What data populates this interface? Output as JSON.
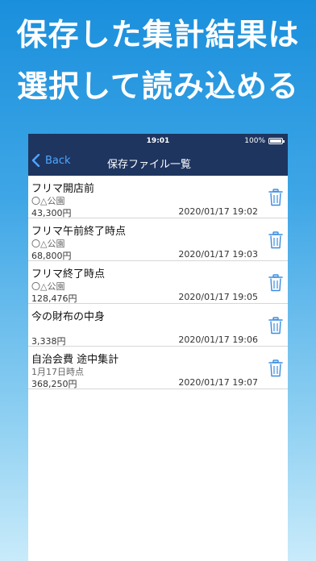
{
  "headline": {
    "line1": "保存した集計結果は",
    "line2": "選択して読み込める"
  },
  "status_bar": {
    "time": "19:01",
    "battery": "100%"
  },
  "nav": {
    "back_label": "Back",
    "title": "保存ファイル一覧"
  },
  "files": [
    {
      "title": "フリマ開店前",
      "subtitle": "〇△公園",
      "amount": "43,300円",
      "date": "2020/01/17 19:02"
    },
    {
      "title": "フリマ午前終了時点",
      "subtitle": "〇△公園",
      "amount": "68,800円",
      "date": "2020/01/17 19:03"
    },
    {
      "title": "フリマ終了時点",
      "subtitle": "〇△公園",
      "amount": "128,476円",
      "date": "2020/01/17 19:05"
    },
    {
      "title": "今の財布の中身",
      "subtitle": "",
      "amount": "3,338円",
      "date": "2020/01/17 19:06"
    },
    {
      "title": "自治会費 途中集計",
      "subtitle": "1月17日時点",
      "amount": "368,250円",
      "date": "2020/01/17 19:07"
    }
  ],
  "colors": {
    "nav_bar": "#1e3560",
    "back_link": "#4ea7ff",
    "trash_icon": "#3b8de0"
  }
}
